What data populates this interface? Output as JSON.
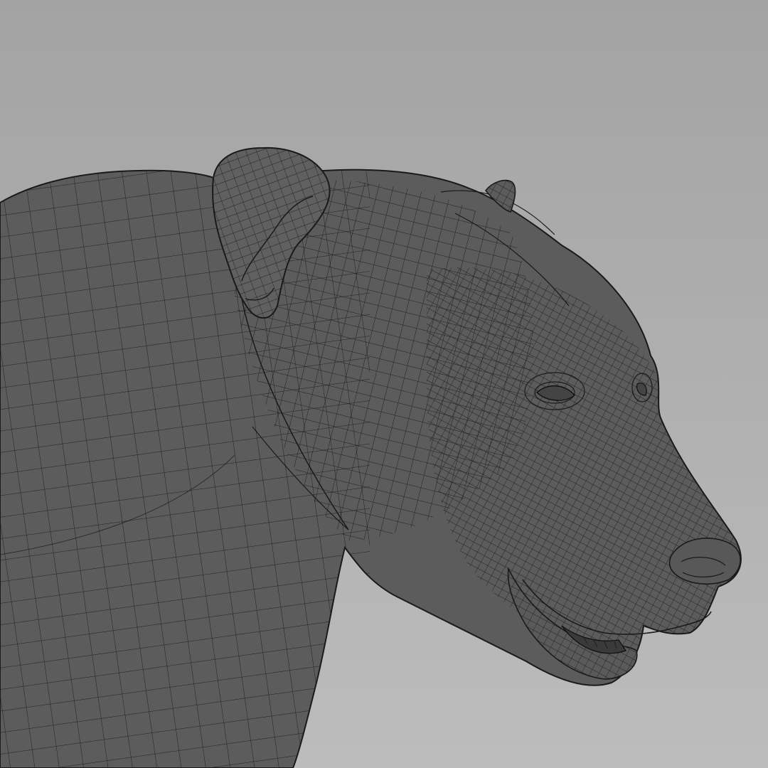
{
  "viewport": {
    "background_top": "#a3a3a3",
    "background_bottom": "#bcbcbc"
  },
  "model": {
    "subject": "bear",
    "shading": "wireframe-on-shaded",
    "surface_color": "#5c5c5c",
    "wire_color": "#1a1a1a"
  }
}
